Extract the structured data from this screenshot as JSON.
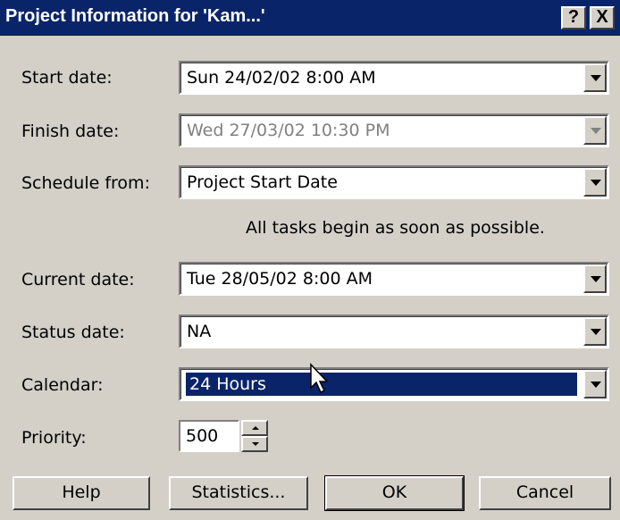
{
  "window": {
    "title": "Project Information for 'Kam...'",
    "help_button": "?",
    "close_button": "X"
  },
  "fields": {
    "start_date": {
      "label": "Start date:",
      "value": "Sun 24/02/02 8:00 AM"
    },
    "finish_date": {
      "label": "Finish date:",
      "value": "Wed 27/03/02 10:30 PM",
      "disabled": true
    },
    "schedule_from": {
      "label": "Schedule from:",
      "value": "Project Start Date"
    },
    "current_date": {
      "label": "Current date:",
      "value": "Tue 28/05/02 8:00 AM"
    },
    "status_date": {
      "label": "Status date:",
      "value": "NA"
    },
    "calendar": {
      "label": "Calendar:",
      "value": "24 Hours",
      "selected": true
    },
    "priority": {
      "label": "Priority:",
      "value": "500"
    }
  },
  "hint_text": "All tasks begin as soon as possible.",
  "buttons": {
    "help": "Help",
    "statistics": "Statistics...",
    "ok": "OK",
    "cancel": "Cancel"
  },
  "colors": {
    "titlebar": "#0a246a",
    "dialog_bg": "#d4d0c8",
    "selection": "#0a246a"
  },
  "icons": {
    "cursor": "arrow-cursor-icon",
    "dropdown": "dropdown-arrow-icon"
  }
}
